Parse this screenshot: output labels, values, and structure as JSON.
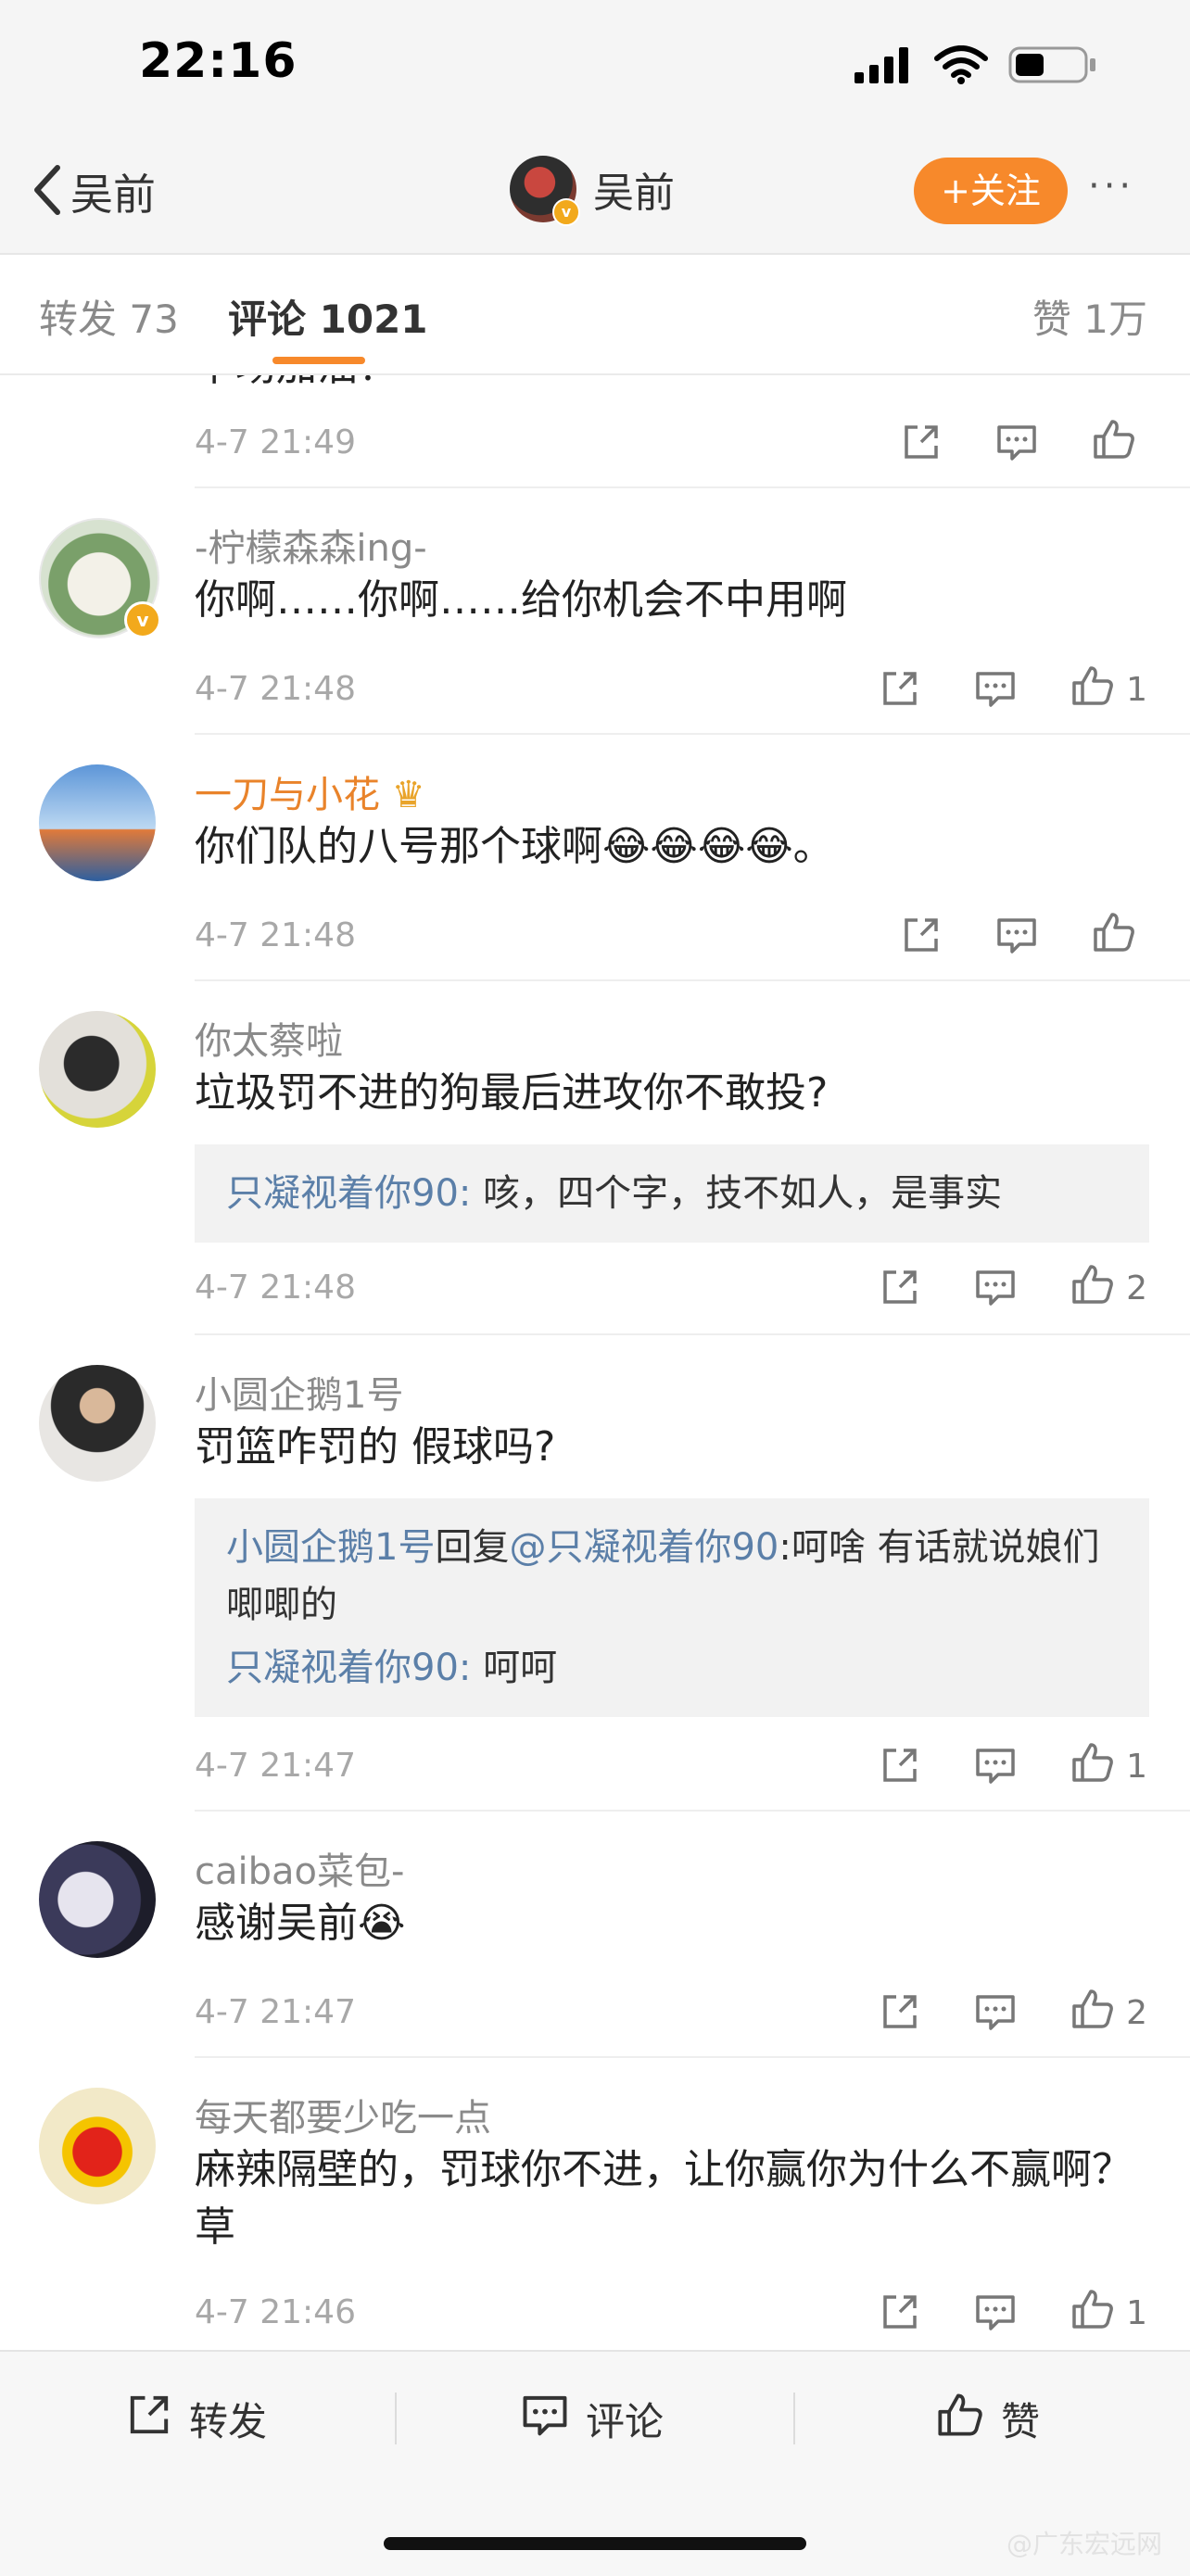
{
  "status_bar": {
    "time": "22:16"
  },
  "nav": {
    "back_label": "吴前",
    "center_name": "吴前",
    "follow_label": "+关注",
    "more_label": "···"
  },
  "tabs": {
    "repost": "转发 73",
    "comments": "评论 1021",
    "likes": "赞 1万"
  },
  "comments": [
    {
      "name": "",
      "text": "下场加油！",
      "time": "4-7 21:49",
      "likes": ""
    },
    {
      "name": "-柠檬森森ing-",
      "text": "你啊……你啊……给你机会不中用啊",
      "time": "4-7 21:48",
      "likes": "1"
    },
    {
      "name": "一刀与小花",
      "text": "你们队的八号那个球啊😂😂😂😂。",
      "time": "4-7 21:48",
      "likes": ""
    },
    {
      "name": "你太蔡啦",
      "text": "垃圾罚不进的狗最后进攻你不敢投?",
      "reply_user": "只凝视着你90:",
      "reply_text": " 咳，四个字，技不如人，是事实",
      "time": "4-7 21:48",
      "likes": "2"
    },
    {
      "name": "小圆企鹅1号",
      "text": "罚篮咋罚的 假球吗?",
      "reply1_user": "小圆企鹅1号",
      "reply1_mid": "回复",
      "reply1_at": "@只凝视着你90",
      "reply1_text": ":呵啥 有话就说娘们唧唧的",
      "reply2_user": "只凝视着你90:",
      "reply2_text": " 呵呵",
      "time": "4-7 21:47",
      "likes": "1"
    },
    {
      "name": "caibao菜包-",
      "text": "感谢吴前😭",
      "time": "4-7 21:47",
      "likes": "2"
    },
    {
      "name": "每天都要少吃一点",
      "text": "麻辣隔壁的，罚球你不进，让你赢你为什么不赢啊？草",
      "time": "4-7 21:46",
      "likes": "1"
    }
  ],
  "bottom_bar": {
    "repost": "转发",
    "comment": "评论",
    "like": "赞"
  },
  "watermark": "@广东宏远网",
  "colors": {
    "accent": "#f7892b",
    "link": "#5b7fa8",
    "gold_name": "#e9832a"
  },
  "icons": [
    "signal-icon",
    "wifi-icon",
    "battery-icon",
    "back-chevron-icon",
    "verified-badge-icon",
    "crown-icon",
    "share-icon",
    "comment-icon",
    "like-icon"
  ]
}
